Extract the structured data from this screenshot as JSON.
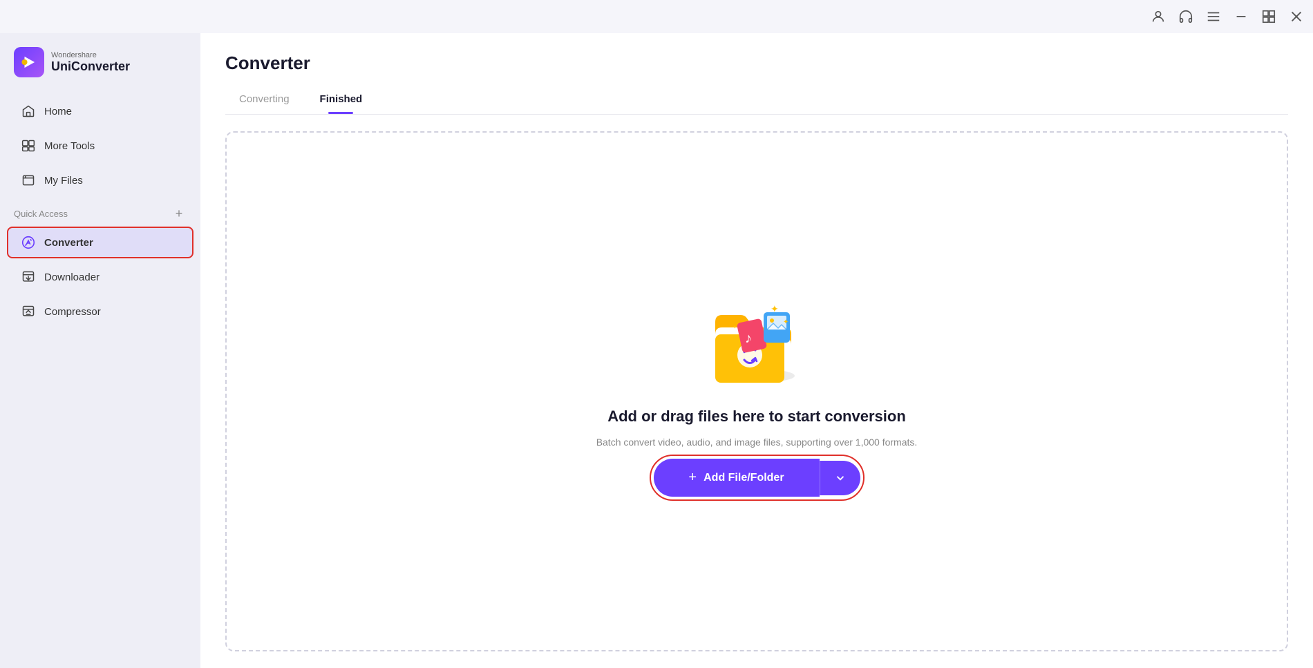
{
  "titlebar": {
    "icons": [
      {
        "name": "user-icon",
        "symbol": "👤"
      },
      {
        "name": "headset-icon",
        "symbol": "🎧"
      },
      {
        "name": "menu-icon",
        "symbol": "☰"
      },
      {
        "name": "minimize-icon",
        "symbol": "—"
      },
      {
        "name": "maximize-icon",
        "symbol": "⧉"
      },
      {
        "name": "close-icon",
        "symbol": "✕"
      }
    ]
  },
  "sidebar": {
    "logo": {
      "brand": "Wondershare",
      "name": "UniConverter"
    },
    "nav_items": [
      {
        "id": "home",
        "label": "Home",
        "icon": "home-icon"
      },
      {
        "id": "more-tools",
        "label": "More Tools",
        "icon": "more-tools-icon"
      },
      {
        "id": "my-files",
        "label": "My Files",
        "icon": "my-files-icon"
      }
    ],
    "quick_access_label": "Quick Access",
    "quick_access_add_label": "+",
    "quick_access_items": [
      {
        "id": "converter",
        "label": "Converter",
        "icon": "converter-icon"
      },
      {
        "id": "downloader",
        "label": "Downloader",
        "icon": "downloader-icon"
      },
      {
        "id": "compressor",
        "label": "Compressor",
        "icon": "compressor-icon"
      }
    ]
  },
  "main": {
    "title": "Converter",
    "tabs": [
      {
        "id": "converting",
        "label": "Converting",
        "active": false
      },
      {
        "id": "finished",
        "label": "Finished",
        "active": true
      }
    ],
    "drop_zone": {
      "title": "Add or drag files here to start conversion",
      "subtitle": "Batch convert video, audio, and image files, supporting over 1,000 formats.",
      "button_label": "Add File/Folder",
      "button_plus": "+"
    }
  }
}
